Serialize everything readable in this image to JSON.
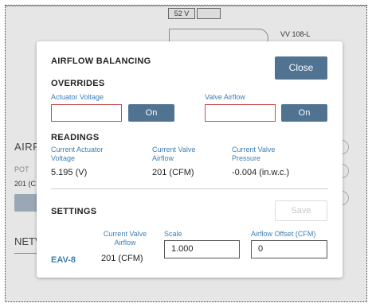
{
  "background": {
    "voltage_label": "52 V",
    "vv_label": "VV 108-L",
    "section_label": "AIRF",
    "pot_label": "POT",
    "value_label": "201 (C",
    "netv_label": "NETV"
  },
  "modal": {
    "title": "AIRFLOW BALANCING",
    "close_label": "Close",
    "overrides": {
      "title": "OVERRIDES",
      "actuator_voltage_label": "Actuator Voltage",
      "actuator_voltage_value": "",
      "actuator_on_label": "On",
      "valve_airflow_label": "Valve Airflow",
      "valve_airflow_value": "",
      "valve_on_label": "On"
    },
    "readings": {
      "title": "READINGS",
      "actuator_voltage_label_1": "Current Actuator",
      "actuator_voltage_label_2": "Voltage",
      "actuator_voltage_value": "5.195 (V)",
      "valve_airflow_label_1": "Current Valve",
      "valve_airflow_label_2": "Airflow",
      "valve_airflow_value": "201 (CFM)",
      "valve_pressure_label_1": "Current Valve",
      "valve_pressure_label_2": "Pressure",
      "valve_pressure_value": "-0.004 (in.w.c.)"
    },
    "settings": {
      "title": "SETTINGS",
      "save_label": "Save",
      "device_name": "EAV-8",
      "current_airflow_label_1": "Current Valve",
      "current_airflow_label_2": "Airflow",
      "current_airflow_value": "201 (CFM)",
      "scale_label": "Scale",
      "scale_value": "1.000",
      "offset_label": "Airflow Offset (CFM)",
      "offset_value": "0"
    }
  },
  "colors": {
    "accent": "#4f7391",
    "label_blue": "#3d7fb3",
    "error_red": "#c94a4a"
  }
}
